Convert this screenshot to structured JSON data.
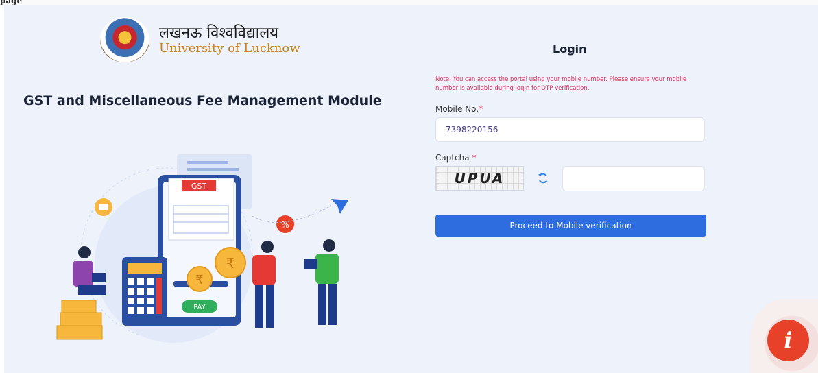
{
  "header": {
    "clipped_text": "page"
  },
  "logo": {
    "hindi_name": "लखनऊ विश्वविद्यालय",
    "english_name": "University of Lucknow"
  },
  "module": {
    "title": "GST and Miscellaneous Fee Management Module"
  },
  "illustration": {
    "gst_label": "GST",
    "pay_label": "PAY",
    "rupee_symbol": "₹",
    "percent_symbol": "%"
  },
  "login": {
    "title": "Login",
    "note": "Note: You can access the portal using your mobile number. Please ensure your mobile number is available during login for OTP verification.",
    "mobile_label": "Mobile No.",
    "required_mark": "*",
    "mobile_value": "7398220156",
    "captcha_label": "Captcha ",
    "captcha_text": "UPUA",
    "captcha_input_value": "",
    "proceed_label": "Proceed to Mobile verification"
  },
  "info_button": {
    "label": "i"
  },
  "colors": {
    "accent": "#2d6de0",
    "note": "#e0325b",
    "info": "#e8412a",
    "background": "#eef2fb"
  }
}
